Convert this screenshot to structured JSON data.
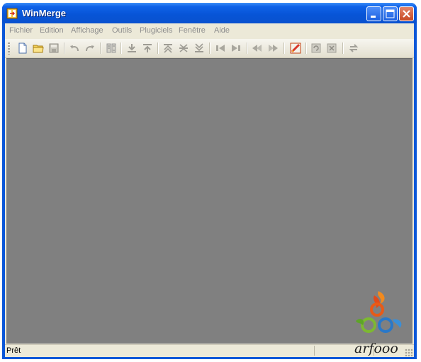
{
  "window": {
    "title": "WinMerge"
  },
  "menu": {
    "items": [
      {
        "id": "fichier",
        "label": "Fichier"
      },
      {
        "id": "edition",
        "label": "Edition"
      },
      {
        "id": "affichage",
        "label": "Affichage"
      },
      {
        "id": "outils",
        "label": "Outils"
      },
      {
        "id": "plugiciels",
        "label": "Plugiciels"
      },
      {
        "id": "fenetre",
        "label": "Fenêtre"
      },
      {
        "id": "aide",
        "label": "Aide"
      }
    ]
  },
  "toolbar": {
    "icons": [
      "new-document-icon",
      "open-folder-icon",
      "save-icon",
      "undo-icon",
      "redo-icon",
      "merge-mode-icon",
      "next-diff-icon",
      "prev-diff-icon",
      "first-diff-icon",
      "current-diff-icon",
      "last-diff-icon",
      "copy-left-icon",
      "copy-right-icon",
      "copy-all-left-icon",
      "copy-all-right-icon",
      "options-icon",
      "refresh-icon",
      "rescan-icon",
      "swap-panes-icon"
    ]
  },
  "status": {
    "text": "Prêt"
  },
  "logo": {
    "text": "arfooo"
  },
  "colors": {
    "titlebar": "#0754d6",
    "workspace": "#808080",
    "chrome": "#ece9d8",
    "disabled_text": "#8d8d8d"
  }
}
